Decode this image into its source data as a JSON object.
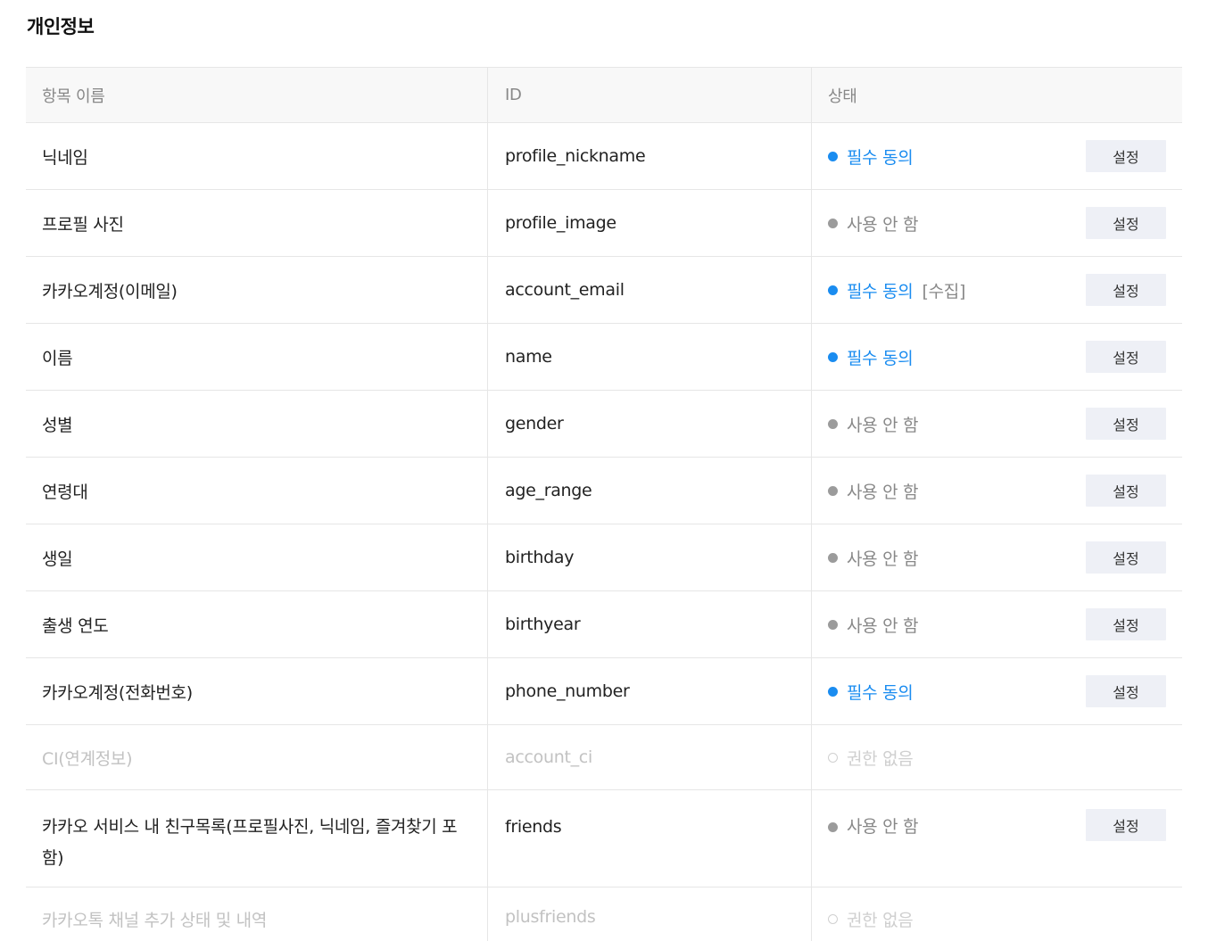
{
  "section_title": "개인정보",
  "columns": {
    "name": "항목 이름",
    "id": "ID",
    "status": "상태"
  },
  "button_label": "설정",
  "colors": {
    "required": "#1a8cf0",
    "unused": "#888888",
    "no_permission": "#cfcfcf",
    "button_bg": "#eef0f6"
  },
  "rows": [
    {
      "name": "닉네임",
      "id": "profile_nickname",
      "status": "필수 동의",
      "kind": "required",
      "extra": "",
      "has_button": true
    },
    {
      "name": "프로필 사진",
      "id": "profile_image",
      "status": "사용 안 함",
      "kind": "unused",
      "extra": "",
      "has_button": true
    },
    {
      "name": "카카오계정(이메일)",
      "id": "account_email",
      "status": "필수 동의",
      "kind": "required",
      "extra": "[수집]",
      "has_button": true
    },
    {
      "name": "이름",
      "id": "name",
      "status": "필수 동의",
      "kind": "required",
      "extra": "",
      "has_button": true
    },
    {
      "name": "성별",
      "id": "gender",
      "status": "사용 안 함",
      "kind": "unused",
      "extra": "",
      "has_button": true
    },
    {
      "name": "연령대",
      "id": "age_range",
      "status": "사용 안 함",
      "kind": "unused",
      "extra": "",
      "has_button": true
    },
    {
      "name": "생일",
      "id": "birthday",
      "status": "사용 안 함",
      "kind": "unused",
      "extra": "",
      "has_button": true
    },
    {
      "name": "출생 연도",
      "id": "birthyear",
      "status": "사용 안 함",
      "kind": "unused",
      "extra": "",
      "has_button": true
    },
    {
      "name": "카카오계정(전화번호)",
      "id": "phone_number",
      "status": "필수 동의",
      "kind": "required",
      "extra": "",
      "has_button": true
    },
    {
      "name": "CI(연계정보)",
      "id": "account_ci",
      "status": "권한 없음",
      "kind": "none",
      "extra": "",
      "has_button": false
    },
    {
      "name": "카카오 서비스 내 친구목록(프로필사진, 닉네임, 즐겨찾기 포함)",
      "id": "friends",
      "status": "사용 안 함",
      "kind": "unused",
      "extra": "",
      "has_button": true
    },
    {
      "name": "카카오톡 채널 추가 상태 및 내역",
      "id": "plusfriends",
      "status": "권한 없음",
      "kind": "none",
      "extra": "",
      "has_button": false
    }
  ]
}
